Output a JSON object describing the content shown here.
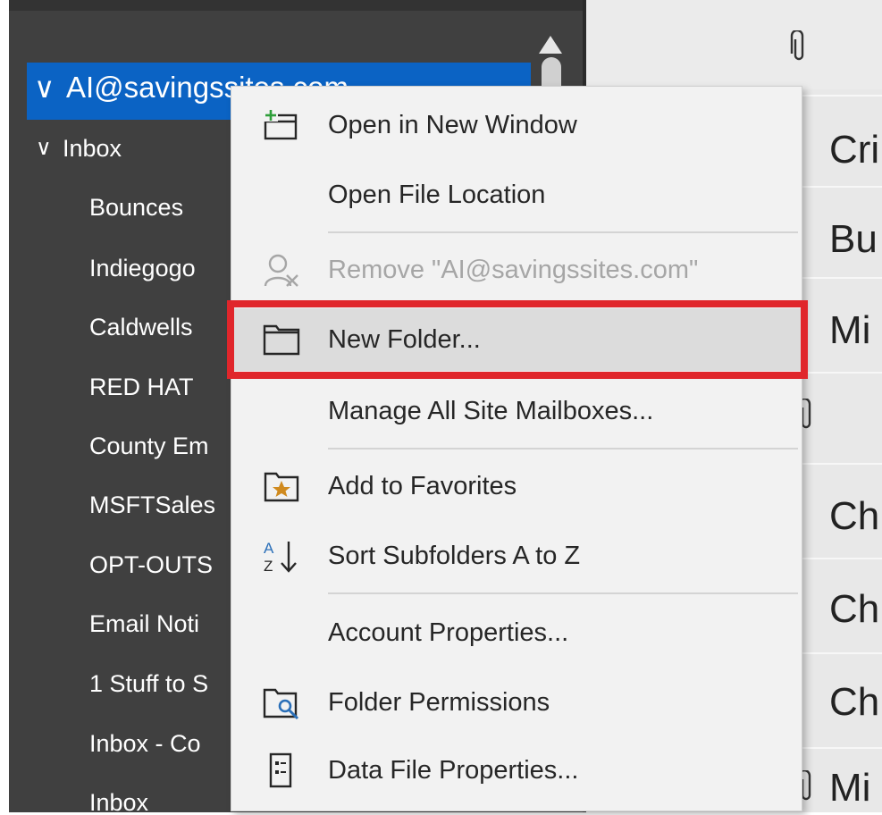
{
  "folder_pane": {
    "account": {
      "chevron": "∨",
      "label": "AI@savingssites.com"
    },
    "inbox": {
      "chevron": "∨",
      "label": "Inbox"
    },
    "folders": [
      "Bounces",
      "Indiegogo",
      "Caldwells",
      "RED HAT",
      "County Em",
      "MSFTSales",
      "OPT-OUTS",
      "Email Noti",
      "1 Stuff to S",
      "Inbox - Co",
      "Inbox"
    ]
  },
  "message_list": {
    "names": [
      "Cri",
      "Bu",
      "Mi",
      "Ch",
      "Ch",
      "Ch",
      "Mi"
    ],
    "attach_icon": "paperclip-icon"
  },
  "context_menu": {
    "items": [
      {
        "label": "Open in New Window",
        "icon": "new-window-icon"
      },
      {
        "label": "Open File Location",
        "icon": ""
      },
      {
        "label": "Remove \"AI@savingssites.com\"",
        "icon": "remove-user-icon",
        "disabled": true
      },
      {
        "label": "New Folder...",
        "icon": "folder-icon",
        "highlighted": true
      },
      {
        "label": "Manage All Site Mailboxes...",
        "icon": ""
      },
      {
        "label": "Add to Favorites",
        "icon": "star-folder-icon"
      },
      {
        "label": "Sort Subfolders A to Z",
        "icon": "sort-az-icon",
        "sort_glyph_top": "A",
        "sort_glyph_bottom": "Z"
      },
      {
        "label": "Account Properties...",
        "icon": ""
      },
      {
        "label": "Folder Permissions",
        "icon": "folder-permissions-icon"
      },
      {
        "label": "Data File Properties...",
        "icon": "data-file-icon"
      }
    ]
  },
  "colors": {
    "pane_background": "#404040",
    "selection": "#0b63c4",
    "menu_background": "#f2f2f2",
    "highlight_border": "#e0262b",
    "new_window_plus": "#2e9e3a",
    "favorite_star": "#d08a1e",
    "permissions_accent": "#2a6fb8"
  }
}
